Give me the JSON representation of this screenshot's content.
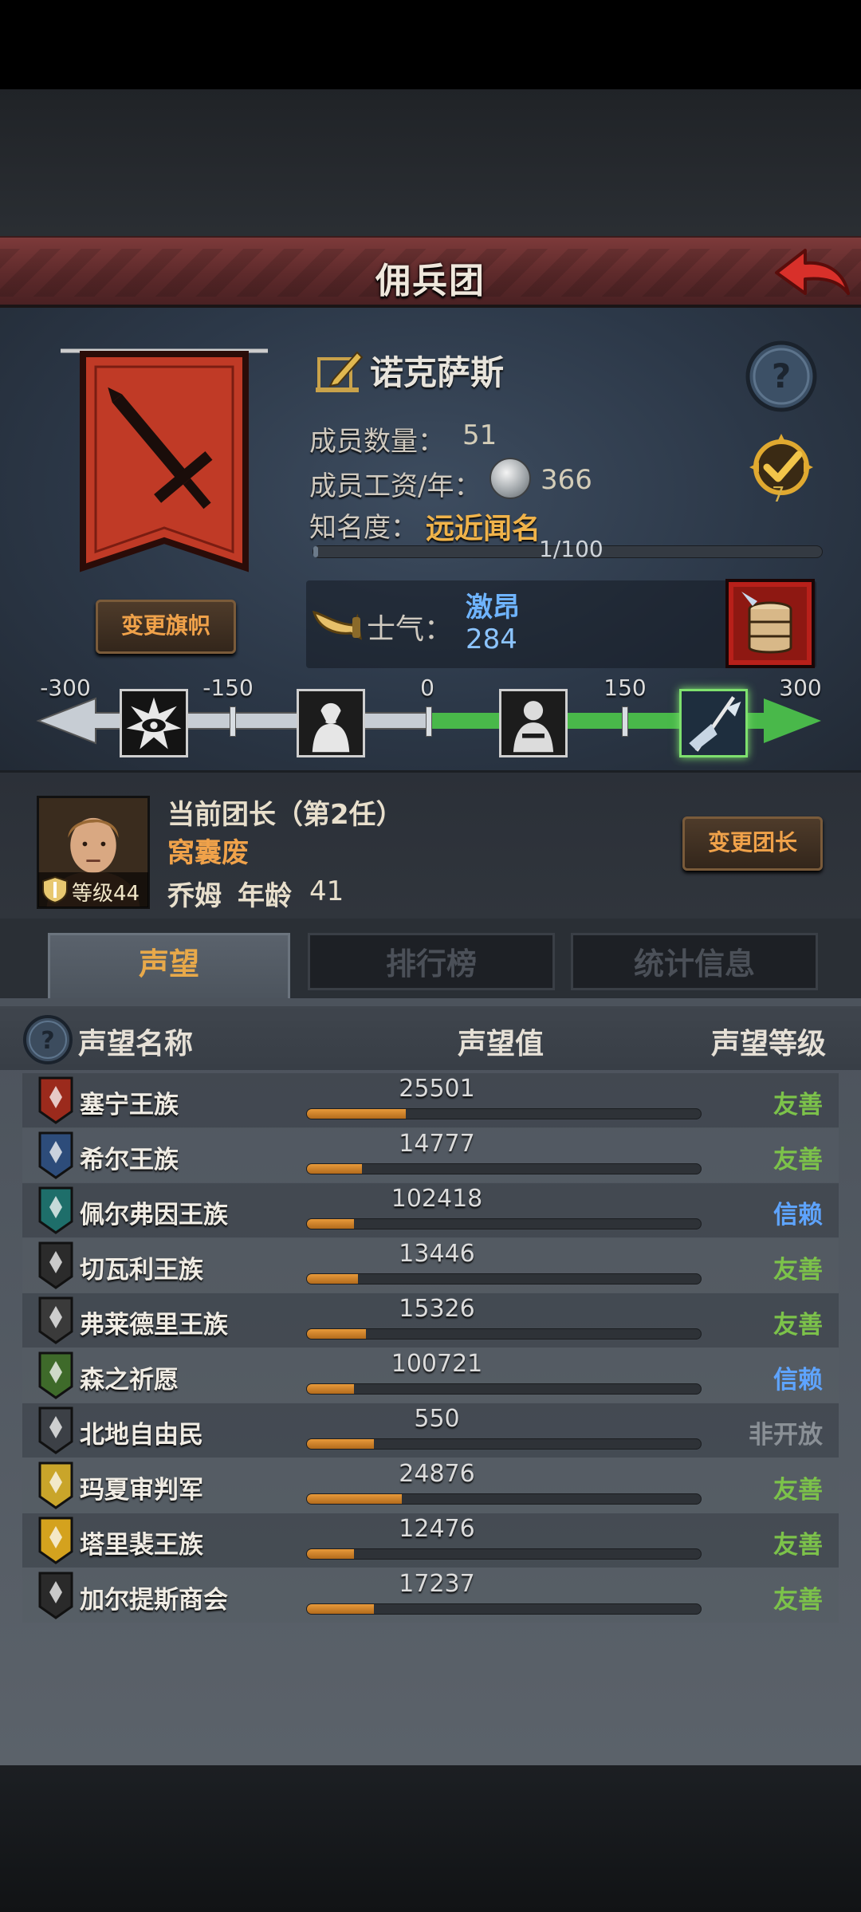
{
  "header": {
    "title": "佣兵团"
  },
  "company": {
    "name": "诺克萨斯",
    "members_label": "成员数量：",
    "members_value": "51",
    "wage_label": "成员工资/年：",
    "wage_value": "366",
    "fame_label": "知名度：",
    "fame_value": "远近闻名",
    "fame_progress": "1/100",
    "fame_fraction": 0.01,
    "achievement_count": "7",
    "change_banner_label": "变更旗帜"
  },
  "morale": {
    "label": "士气：",
    "state": "激昂",
    "value": "284",
    "scale_ticks": [
      "-300",
      "-150",
      "0",
      "150",
      "300"
    ]
  },
  "leader": {
    "title": "当前团长（第2任）",
    "trait": "窝囊废",
    "name": "乔姆",
    "age_label": "年龄",
    "age": "41",
    "level": "等级44",
    "change_label": "变更团长"
  },
  "tabs": [
    {
      "label": "声望"
    },
    {
      "label": "排行榜"
    },
    {
      "label": "统计信息"
    }
  ],
  "reputation": {
    "headers": {
      "name": "声望名称",
      "value": "声望值",
      "level": "声望等级"
    },
    "rows": [
      {
        "name": "塞宁王族",
        "value": "25501",
        "fill": 0.25,
        "level": "友善",
        "level_color": "#7cc24a",
        "crest_color": "#9b2a1c"
      },
      {
        "name": "希尔王族",
        "value": "14777",
        "fill": 0.14,
        "level": "友善",
        "level_color": "#7cc24a",
        "crest_color": "#2d4c7a"
      },
      {
        "name": "佩尔弗因王族",
        "value": "102418",
        "fill": 0.12,
        "level": "信赖",
        "level_color": "#5ea4ff",
        "crest_color": "#1e6e6a"
      },
      {
        "name": "切瓦利王族",
        "value": "13446",
        "fill": 0.13,
        "level": "友善",
        "level_color": "#7cc24a",
        "crest_color": "#2b2b2b"
      },
      {
        "name": "弗莱德里王族",
        "value": "15326",
        "fill": 0.15,
        "level": "友善",
        "level_color": "#7cc24a",
        "crest_color": "#3a3a3a"
      },
      {
        "name": "森之祈愿",
        "value": "100721",
        "fill": 0.12,
        "level": "信赖",
        "level_color": "#5ea4ff",
        "crest_color": "#3e6a2a"
      },
      {
        "name": "北地自由民",
        "value": "550",
        "fill": 0.17,
        "level": "非开放",
        "level_color": "#8a9096",
        "crest_color": "#3c4046"
      },
      {
        "name": "玛夏审判军",
        "value": "24876",
        "fill": 0.24,
        "level": "友善",
        "level_color": "#7cc24a",
        "crest_color": "#c9a52a"
      },
      {
        "name": "塔里裴王族",
        "value": "12476",
        "fill": 0.12,
        "level": "友善",
        "level_color": "#7cc24a",
        "crest_color": "#d4a21e"
      },
      {
        "name": "加尔提斯商会",
        "value": "17237",
        "fill": 0.17,
        "level": "友善",
        "level_color": "#7cc24a",
        "crest_color": "#2a2a2a"
      }
    ]
  }
}
